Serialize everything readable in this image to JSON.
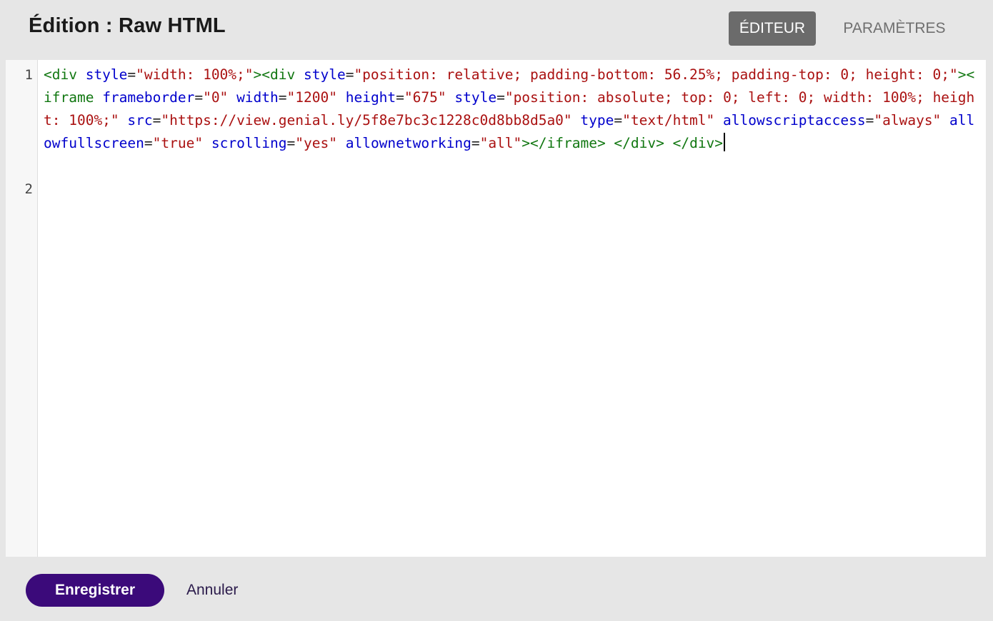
{
  "header": {
    "title": "Édition : Raw HTML",
    "tabs": [
      {
        "label": "ÉDITEUR",
        "active": true
      },
      {
        "label": "PARAMÈTRES",
        "active": false
      }
    ]
  },
  "editor": {
    "line_numbers": [
      "1",
      "2"
    ],
    "lines": [
      [
        {
          "t": "tag",
          "v": "<div "
        },
        {
          "t": "attr",
          "v": "style"
        },
        {
          "t": "punc",
          "v": "="
        },
        {
          "t": "str",
          "v": "\"width: 100%;\""
        },
        {
          "t": "tag",
          "v": "><div "
        },
        {
          "t": "attr",
          "v": "style"
        },
        {
          "t": "punc",
          "v": "="
        },
        {
          "t": "str",
          "v": "\"position: relative; padding-bottom: 56.25%; padding-top: 0; height: 0;\""
        },
        {
          "t": "tag",
          "v": "><iframe "
        },
        {
          "t": "attr",
          "v": "frameborder"
        },
        {
          "t": "punc",
          "v": "="
        },
        {
          "t": "str",
          "v": "\"0\""
        },
        {
          "t": "punc",
          "v": " "
        },
        {
          "t": "attr",
          "v": "width"
        },
        {
          "t": "punc",
          "v": "="
        },
        {
          "t": "str",
          "v": "\"1200\""
        },
        {
          "t": "punc",
          "v": " "
        },
        {
          "t": "attr",
          "v": "height"
        },
        {
          "t": "punc",
          "v": "="
        },
        {
          "t": "str",
          "v": "\"675\""
        },
        {
          "t": "punc",
          "v": " "
        },
        {
          "t": "attr",
          "v": "style"
        },
        {
          "t": "punc",
          "v": "="
        },
        {
          "t": "str",
          "v": "\"position: absolute; top: 0; left: 0; width: 100%; height: 100%;\""
        },
        {
          "t": "punc",
          "v": " "
        },
        {
          "t": "attr",
          "v": "src"
        },
        {
          "t": "punc",
          "v": "="
        },
        {
          "t": "str",
          "v": "\"https://view.genial.ly/5f8e7bc3c1228c0d8bb8d5a0\""
        },
        {
          "t": "punc",
          "v": " "
        },
        {
          "t": "attr",
          "v": "type"
        },
        {
          "t": "punc",
          "v": "="
        },
        {
          "t": "str",
          "v": "\"text/html\""
        },
        {
          "t": "punc",
          "v": " "
        },
        {
          "t": "attr",
          "v": "allowscriptaccess"
        },
        {
          "t": "punc",
          "v": "="
        },
        {
          "t": "str",
          "v": "\"always\""
        },
        {
          "t": "punc",
          "v": " "
        },
        {
          "t": "attr",
          "v": "allowfullscreen"
        },
        {
          "t": "punc",
          "v": "="
        },
        {
          "t": "str",
          "v": "\"true\""
        },
        {
          "t": "punc",
          "v": " "
        },
        {
          "t": "attr",
          "v": "scrolling"
        },
        {
          "t": "punc",
          "v": "="
        },
        {
          "t": "str",
          "v": "\"yes\""
        },
        {
          "t": "punc",
          "v": " "
        },
        {
          "t": "attr",
          "v": "allownetworking"
        },
        {
          "t": "punc",
          "v": "="
        },
        {
          "t": "str",
          "v": "\"all\""
        },
        {
          "t": "tag",
          "v": "></iframe> </div> </div>"
        }
      ],
      []
    ]
  },
  "footer": {
    "save_label": "Enregistrer",
    "cancel_label": "Annuler"
  },
  "colors": {
    "tag": "#117711",
    "attr": "#0000cc",
    "string": "#aa1111",
    "save_button": "#3b0a7a",
    "active_tab": "#6b6b6b"
  }
}
